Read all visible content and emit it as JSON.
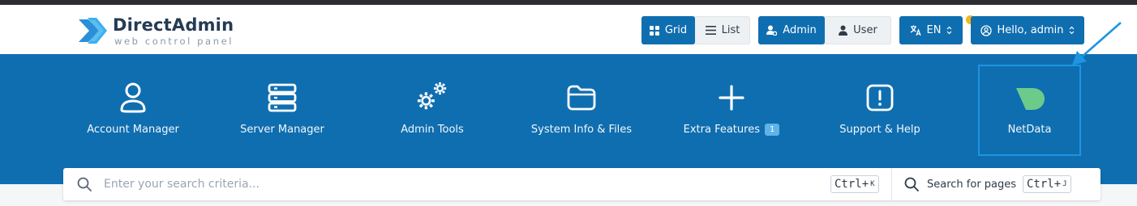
{
  "brand": {
    "title": "DirectAdmin",
    "subtitle": "web control panel",
    "colors": {
      "primary": "#0f6eb0",
      "navy": "#243b53",
      "netdata_green": "#6ccb8b",
      "highlight": "#1d95e2",
      "notify": "#f7b519"
    }
  },
  "toolbar": {
    "view": {
      "grid_label": "Grid",
      "list_label": "List",
      "active": "Grid"
    },
    "level": {
      "admin_label": "Admin",
      "user_label": "User",
      "active": "Admin"
    },
    "language": {
      "label": "EN"
    },
    "account": {
      "label": "Hello, admin"
    }
  },
  "nav": {
    "items": [
      {
        "label": "Account Manager",
        "icon": "user-icon"
      },
      {
        "label": "Server Manager",
        "icon": "server-icon"
      },
      {
        "label": "Admin Tools",
        "icon": "gears-icon"
      },
      {
        "label": "System Info & Files",
        "icon": "folder-icon"
      },
      {
        "label": "Extra Features",
        "icon": "plus-icon",
        "badge": "1"
      },
      {
        "label": "Support & Help",
        "icon": "alert-icon"
      },
      {
        "label": "NetData",
        "icon": "netdata-icon"
      }
    ]
  },
  "search": {
    "placeholder": "Enter your search criteria...",
    "shortcut_main": "Ctrl+",
    "shortcut_key": "K",
    "pages_label": "Search for pages",
    "pages_shortcut_main": "Ctrl+",
    "pages_shortcut_key": "J"
  }
}
